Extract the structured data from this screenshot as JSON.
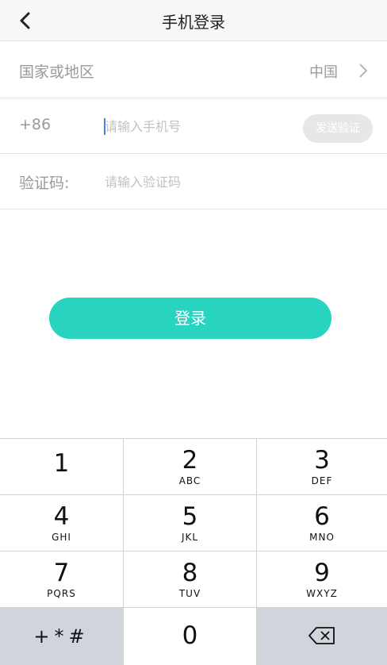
{
  "nav": {
    "title": "手机登录"
  },
  "form": {
    "country_label": "国家或地区",
    "country_value": "中国",
    "phone_prefix": "+86",
    "phone_placeholder": "请输入手机号",
    "send_code_label": "发送验证",
    "code_label": "验证码:",
    "code_placeholder": "请输入验证码"
  },
  "login": {
    "label": "登录"
  },
  "keypad": {
    "keys": [
      {
        "num": "1",
        "letters": ""
      },
      {
        "num": "2",
        "letters": "ABC"
      },
      {
        "num": "3",
        "letters": "DEF"
      },
      {
        "num": "4",
        "letters": "GHI"
      },
      {
        "num": "5",
        "letters": "JKL"
      },
      {
        "num": "6",
        "letters": "MNO"
      },
      {
        "num": "7",
        "letters": "PQRS"
      },
      {
        "num": "8",
        "letters": "TUV"
      },
      {
        "num": "9",
        "letters": "WXYZ"
      }
    ],
    "symbols": "+*#",
    "zero": "0",
    "delete_icon": "backspace-icon"
  },
  "colors": {
    "accent": "#28d3c0",
    "send_button_bg": "#e7e7e7",
    "keypad_bg": "#cfd3d8"
  }
}
